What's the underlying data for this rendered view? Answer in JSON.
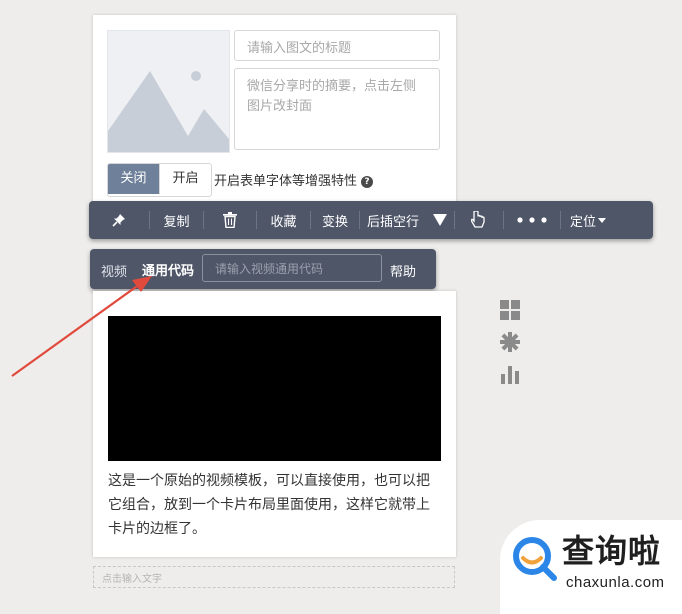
{
  "article": {
    "title_placeholder": "请输入图文的标题",
    "summary_placeholder": "微信分享时的摘要，点击左侧图片改封面",
    "toggle": {
      "off_label": "关闭",
      "on_label": "开启",
      "description": "开启表单字体等增强特性",
      "help_icon": "?"
    }
  },
  "toolbar": {
    "pin_icon": "pin-icon",
    "copy": "复制",
    "delete_icon": "trash-icon",
    "favorite": "收藏",
    "transform": "变换",
    "insert_after": "后插空行",
    "down_icon": "triangle-down-icon",
    "pointer_icon": "hand-pointer-icon",
    "more_icon": "more-dots-icon",
    "position": "定位"
  },
  "video_bar": {
    "video_label": "视频",
    "code_label": "通用代码",
    "input_placeholder": "请输入视频通用代码",
    "help": "帮助"
  },
  "video_card": {
    "description": "这是一个原始的视频模板，可以直接使用，也可以把它组合，放到一个卡片布局里面使用，这样它就带上卡片的边框了。"
  },
  "editor": {
    "click_placeholder": "点击输入文字"
  },
  "side_tools": [
    "grid-icon",
    "gear-icon",
    "bar-chart-icon"
  ],
  "watermark": {
    "title": "查询啦",
    "subtitle": "chaxunla.com"
  },
  "colors": {
    "toolbar_bg": "#4f5668",
    "toggle_active": "#6e809a",
    "arrow": "#e04a3c",
    "watermark_blue": "#2b86e8"
  }
}
